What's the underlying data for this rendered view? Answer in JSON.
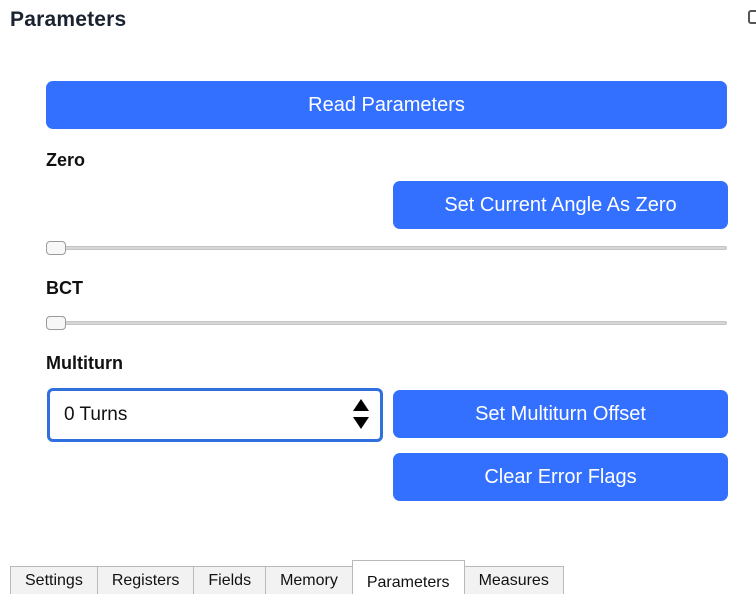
{
  "panel": {
    "title": "Parameters"
  },
  "buttons": {
    "read_parameters": "Read Parameters",
    "set_zero": "Set Current Angle As Zero",
    "set_multiturn_offset": "Set Multiturn Offset",
    "clear_error_flags": "Clear Error Flags"
  },
  "sections": {
    "zero": "Zero",
    "bct": "BCT",
    "multiturn": "Multiturn"
  },
  "sliders": {
    "zero_value": 0,
    "bct_value": 0
  },
  "multiturn_input": {
    "value": "0 Turns"
  },
  "tabs": [
    {
      "label": "Settings"
    },
    {
      "label": "Registers"
    },
    {
      "label": "Fields"
    },
    {
      "label": "Memory"
    },
    {
      "label": "Parameters"
    },
    {
      "label": "Measures"
    }
  ],
  "active_tab": "Parameters",
  "colors": {
    "button": "#3370ff",
    "input_focus_border": "#2f6fde"
  },
  "icons": {
    "corner": "window-icon",
    "spinner": "spin-arrows-icon"
  }
}
